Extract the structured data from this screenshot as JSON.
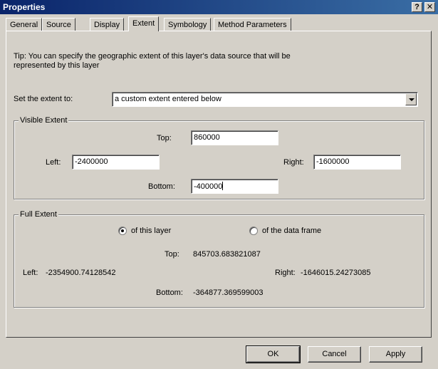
{
  "window": {
    "title": "Properties",
    "help_label": "?",
    "close_label": "✕"
  },
  "tabs": [
    {
      "label": "General"
    },
    {
      "label": "Source"
    },
    {
      "label": "Display"
    },
    {
      "label": "Extent"
    },
    {
      "label": "Symbology"
    },
    {
      "label": "Method Parameters"
    }
  ],
  "active_tab": "Extent",
  "tip": {
    "line1": "Tip:  You can specify the geographic extent of this layer's data source that will be",
    "line2": "represented by this layer"
  },
  "extent_select": {
    "label": "Set the extent to:",
    "value": "a custom extent entered below"
  },
  "visible_extent": {
    "title": "Visible Extent",
    "top_label": "Top:",
    "top_value": "860000",
    "left_label": "Left:",
    "left_value": "-2400000",
    "right_label": "Right:",
    "right_value": "-1600000",
    "bottom_label": "Bottom:",
    "bottom_value": "-400000"
  },
  "full_extent": {
    "title": "Full Extent",
    "option_layer": "of this layer",
    "option_frame": "of the data frame",
    "selected": "of this layer",
    "top_label": "Top:",
    "top_value": "845703.683821087",
    "left_label": "Left:",
    "left_value": "-2354900.74128542",
    "right_label": "Right:",
    "right_value": "-1646015.24273085",
    "bottom_label": "Bottom:",
    "bottom_value": "-364877.369599003"
  },
  "buttons": {
    "ok": "OK",
    "cancel": "Cancel",
    "apply": "Apply"
  }
}
